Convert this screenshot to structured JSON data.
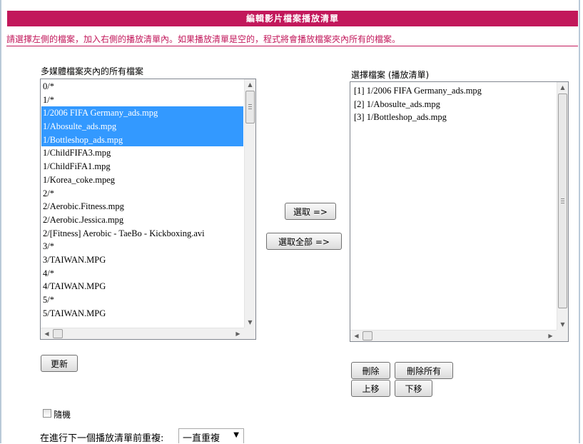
{
  "header": {
    "title": "編輯影片檔案播放清單"
  },
  "instruction": "請選擇左側的檔案，加入右側的播放清單內。如果播放清單是空的，程式將會播放檔案夾內所有的檔案。",
  "files": {
    "label": "多媒體檔案夾內的所有檔案",
    "items": [
      {
        "text": "0/*",
        "selected": false
      },
      {
        "text": "1/*",
        "selected": false
      },
      {
        "text": "1/2006 FIFA Germany_ads.mpg",
        "selected": true
      },
      {
        "text": "1/Abosulte_ads.mpg",
        "selected": true
      },
      {
        "text": "1/Bottleshop_ads.mpg",
        "selected": true
      },
      {
        "text": "1/ChildFIFA3.mpg",
        "selected": false
      },
      {
        "text": "1/ChildFiFA1.mpg",
        "selected": false
      },
      {
        "text": "1/Korea_coke.mpeg",
        "selected": false
      },
      {
        "text": "2/*",
        "selected": false
      },
      {
        "text": "2/Aerobic.Fitness.mpg",
        "selected": false
      },
      {
        "text": "2/Aerobic.Jessica.mpg",
        "selected": false
      },
      {
        "text": "2/[Fitness] Aerobic - TaeBo - Kickboxing.avi",
        "selected": false
      },
      {
        "text": "3/*",
        "selected": false
      },
      {
        "text": "3/TAIWAN.MPG",
        "selected": false
      },
      {
        "text": "4/*",
        "selected": false
      },
      {
        "text": "4/TAIWAN.MPG",
        "selected": false
      },
      {
        "text": "5/*",
        "selected": false
      },
      {
        "text": "5/TAIWAN.MPG",
        "selected": false
      }
    ]
  },
  "playlist": {
    "label": "選擇檔案 (播放清單)",
    "items": [
      "[1] 1/2006 FIFA Germany_ads.mpg",
      "[2] 1/Abosulte_ads.mpg",
      "[3] 1/Bottleshop_ads.mpg"
    ]
  },
  "buttons": {
    "select": "選取 =>",
    "select_all": "選取全部 =>",
    "refresh": "更新",
    "delete": "刪除",
    "delete_all": "刪除所有",
    "move_up": "上移",
    "move_down": "下移"
  },
  "options": {
    "random_label": "隨機",
    "random_checked": false,
    "repeat_label": "在進行下一個播放清單前重複:",
    "repeat_value": "一直重複"
  },
  "colors": {
    "accent": "#c2185b",
    "selection": "#3399ff",
    "border": "#828790"
  },
  "icons": {
    "scroll_up": "scroll-up-arrow-icon",
    "scroll_down": "scroll-down-arrow-icon",
    "scroll_left": "scroll-left-arrow-icon",
    "scroll_right": "scroll-right-arrow-icon",
    "dropdown": "chevron-down-icon"
  }
}
